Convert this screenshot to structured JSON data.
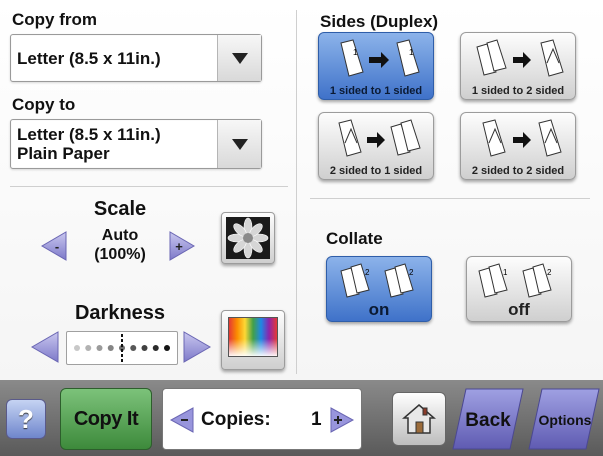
{
  "copy_from": {
    "label": "Copy from",
    "value": "Letter (8.5 x 11in.)"
  },
  "copy_to": {
    "label": "Copy to",
    "value_line1": "Letter (8.5 x 11in.)",
    "value_line2": "Plain Paper"
  },
  "scale": {
    "label": "Scale",
    "mode": "Auto",
    "percent": "(100%)",
    "decrease": "-",
    "increase": "+"
  },
  "darkness": {
    "label": "Darkness",
    "level": 0.5,
    "total_dots": 9
  },
  "sides": {
    "label": "Sides (Duplex)",
    "options": [
      {
        "caption": "1 sided to 1 sided",
        "selected": true
      },
      {
        "caption": "1 sided to 2 sided",
        "selected": false
      },
      {
        "caption": "2 sided to 1 sided",
        "selected": false
      },
      {
        "caption": "2 sided to 2 sided",
        "selected": false
      }
    ]
  },
  "collate": {
    "label": "Collate",
    "options": [
      {
        "caption": "on",
        "selected": true
      },
      {
        "caption": "off",
        "selected": false
      }
    ]
  },
  "bottom": {
    "help": "?",
    "copy_it": "Copy It",
    "copies_label": "Copies:",
    "copies_value": "1",
    "back": "Back",
    "options": "Options"
  },
  "colors": {
    "accent_blue": "#4a7fd4",
    "copy_it_green": "#3d8a3b",
    "back_purple": "#6e6bbd"
  }
}
